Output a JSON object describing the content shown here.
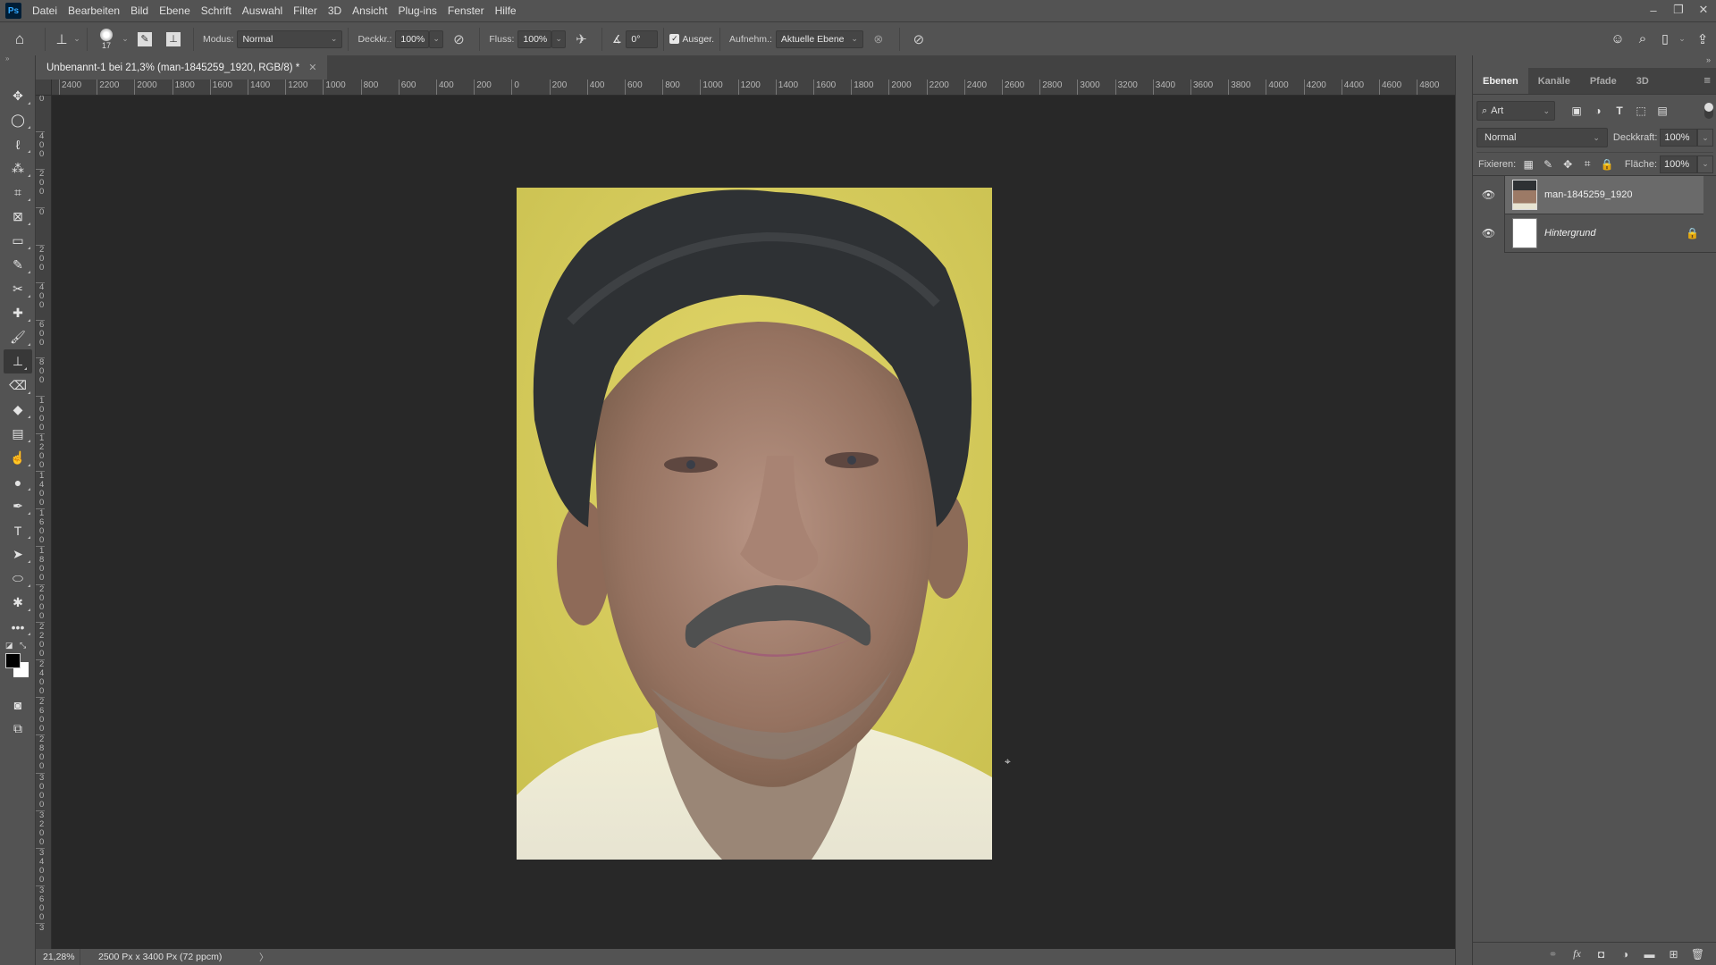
{
  "app": {
    "logo": "Ps",
    "name": "Photoshop"
  },
  "menu": [
    "Datei",
    "Bearbeiten",
    "Bild",
    "Ebene",
    "Schrift",
    "Auswahl",
    "Filter",
    "3D",
    "Ansicht",
    "Plug-ins",
    "Fenster",
    "Hilfe"
  ],
  "window_controls": {
    "minimize": "–",
    "restore": "❐",
    "close": "✕"
  },
  "options_bar": {
    "brush_size": "17",
    "modus_label": "Modus:",
    "modus_value": "Normal",
    "deckkr_label": "Deckkr.:",
    "deckkr_value": "100%",
    "fluss_label": "Fluss:",
    "fluss_value": "100%",
    "angle_value": "0°",
    "ausger_label": "Ausger.",
    "ausger_checked": true,
    "aufnehm_label": "Aufnehm.:",
    "aufnehm_value": "Aktuelle Ebene"
  },
  "document": {
    "tab_title": "Unbenannt-1 bei 21,3% (man-1845259_1920, RGB/8) *",
    "ruler_h": [
      "2400",
      "2200",
      "2000",
      "1800",
      "1600",
      "1400",
      "1200",
      "1000",
      "800",
      "600",
      "400",
      "200",
      "0",
      "200",
      "400",
      "600",
      "800",
      "1000",
      "1200",
      "1400",
      "1600",
      "1800",
      "2000",
      "2200",
      "2400",
      "2600",
      "2800",
      "3000",
      "3200",
      "3400",
      "3600",
      "3800",
      "4000",
      "4200",
      "4400",
      "4600",
      "4800"
    ],
    "ruler_v": [
      "0",
      "400",
      "200",
      "0",
      "200",
      "400",
      "600",
      "800",
      "1000",
      "1200",
      "1400",
      "1600",
      "1800",
      "2000",
      "2200",
      "2400",
      "2600",
      "2800",
      "3000",
      "3200",
      "3400",
      "3600",
      "3"
    ]
  },
  "status": {
    "zoom": "21,28%",
    "doc_info": "2500 Px x 3400 Px (72 ppcm)",
    "arrow": "〉"
  },
  "tools": [
    {
      "name": "move-tool",
      "glyph": "✥"
    },
    {
      "name": "marquee-tool",
      "glyph": "◯"
    },
    {
      "name": "lasso-tool",
      "glyph": "ℓ"
    },
    {
      "name": "magic-wand-tool",
      "glyph": "⁂"
    },
    {
      "name": "crop-tool",
      "glyph": "⌗"
    },
    {
      "name": "frame-tool",
      "glyph": "⊠"
    },
    {
      "name": "ruler-tool",
      "glyph": "▭"
    },
    {
      "name": "eyedropper-tool",
      "glyph": "✎"
    },
    {
      "name": "patch-tool",
      "glyph": "✂"
    },
    {
      "name": "healing-brush-tool",
      "glyph": "✚"
    },
    {
      "name": "brush-tool",
      "glyph": "🖌"
    },
    {
      "name": "clone-stamp-tool",
      "glyph": "⊥",
      "active": true
    },
    {
      "name": "eraser-tool",
      "glyph": "⌫"
    },
    {
      "name": "paint-bucket-tool",
      "glyph": "◆"
    },
    {
      "name": "gradient-tool",
      "glyph": "▤"
    },
    {
      "name": "smudge-tool",
      "glyph": "☝"
    },
    {
      "name": "dodge-tool",
      "glyph": "●"
    },
    {
      "name": "pen-tool",
      "glyph": "✒"
    },
    {
      "name": "type-tool",
      "glyph": "T"
    },
    {
      "name": "path-selection-tool",
      "glyph": "➤"
    },
    {
      "name": "ellipse-tool",
      "glyph": "⬭"
    },
    {
      "name": "custom-shape-tool",
      "glyph": "✱"
    },
    {
      "name": "more-tools",
      "glyph": "•••"
    }
  ],
  "layers_panel": {
    "tabs": [
      "Ebenen",
      "Kanäle",
      "Pfade",
      "3D"
    ],
    "active_tab": "Ebenen",
    "filter_label": "Art",
    "blend_mode": "Normal",
    "opacity_label": "Deckkraft:",
    "opacity_value": "100%",
    "lock_label": "Fixieren:",
    "fill_label": "Fläche:",
    "fill_value": "100%",
    "layers": [
      {
        "name": "man-1845259_1920",
        "visible": true,
        "selected": true,
        "locked": false
      },
      {
        "name": "Hintergrund",
        "visible": true,
        "selected": false,
        "locked": true
      }
    ]
  },
  "colors": {
    "foreground": "#000000",
    "background": "#ffffff"
  }
}
